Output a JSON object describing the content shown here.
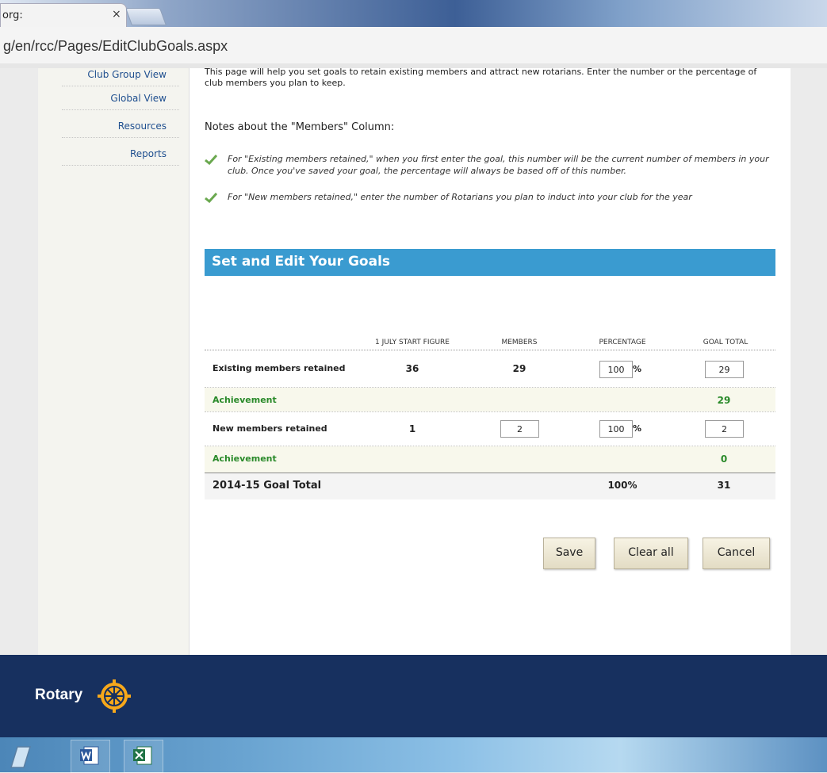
{
  "browser": {
    "tab_title": "org:",
    "tab_close": "×",
    "url": "g/en/rcc/Pages/EditClubGoals.aspx"
  },
  "sidebar": {
    "items": [
      {
        "label": "Club Group View"
      },
      {
        "label": "Global View"
      },
      {
        "label": "Resources"
      },
      {
        "label": "Reports"
      }
    ]
  },
  "intro": "This page will help you set goals to retain existing members and attract new rotarians. Enter the number or the percentage of club members you plan to keep.",
  "notes": {
    "title": "Notes about the \"Members\" Column:",
    "items": [
      "For \"Existing members retained,\" when you first enter the goal, this number will be the current number of members in your club. Once you've saved your goal, the percentage will always be based off of this number.",
      "For \"New members retained,\" enter the number of Rotarians you plan to induct into your club for the year"
    ]
  },
  "section_title": "Set and Edit Your Goals",
  "table": {
    "headers": [
      "1 July start figure",
      "Members",
      "Percentage",
      "Goal total"
    ],
    "existing": {
      "label": "Existing members retained",
      "start": "36",
      "members": "29",
      "percentage": "100",
      "percent_sign": "%",
      "goal": "29"
    },
    "existing_achievement": {
      "label": "Achievement",
      "value": "29"
    },
    "new": {
      "label": "New members retained",
      "start": "1",
      "members": "2",
      "percentage": "100",
      "percent_sign": "%",
      "goal": "2"
    },
    "new_achievement": {
      "label": "Achievement",
      "value": "0"
    },
    "total": {
      "label": "2014-15 Goal Total",
      "percentage": "100%",
      "goal": "31"
    }
  },
  "buttons": {
    "save": "Save",
    "clear": "Clear all",
    "cancel": "Cancel"
  },
  "footer": {
    "logo_text": "Rotary"
  },
  "colors": {
    "banner": "#3a9bd0",
    "footer": "#17305f",
    "achievement": "#2a8a2a",
    "nav_link": "#1f4f8f"
  }
}
